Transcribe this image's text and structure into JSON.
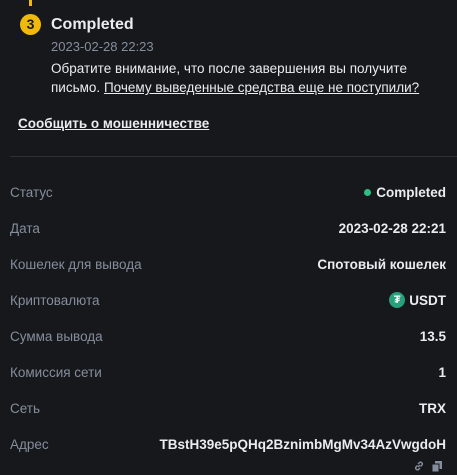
{
  "step": {
    "number": "3",
    "title": "Completed",
    "time": "2023-02-28 22:23",
    "note": "Обратите внимание, что после завершения вы получите письмо.",
    "note_link": "Почему выведенные средства еще не поступили?"
  },
  "fraud_link": "Сообщить о мошенничестве",
  "details": {
    "status": {
      "label": "Статус",
      "value": "Completed"
    },
    "date": {
      "label": "Дата",
      "value": "2023-02-28 22:21"
    },
    "wallet": {
      "label": "Кошелек для вывода",
      "value": "Спотовый кошелек"
    },
    "crypto": {
      "label": "Криптовалюта",
      "value": "USDT"
    },
    "amount": {
      "label": "Сумма вывода",
      "value": "13.5"
    },
    "fee": {
      "label": "Комиссия сети",
      "value": "1"
    },
    "network": {
      "label": "Сеть",
      "value": "TRX"
    },
    "address": {
      "label": "Адрес",
      "value": "TBstH39e5pQHq2BznimbMgMv34AzVwgdoH"
    }
  },
  "colors": {
    "accent": "#f0b90b",
    "success": "#2ebd85",
    "tether": "#26a17b",
    "muted": "#848e9c",
    "background": "#17181c"
  },
  "icons": {
    "step": "step-number-badge",
    "status": "status-dot",
    "crypto": "tether-icon",
    "address_actions": [
      "link-icon",
      "copy-icon"
    ]
  }
}
